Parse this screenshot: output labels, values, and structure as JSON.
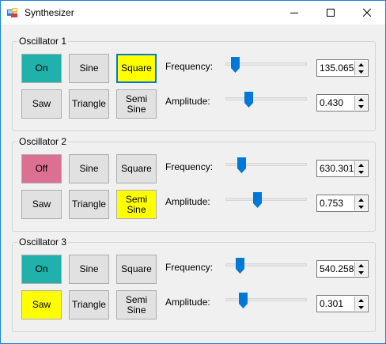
{
  "window": {
    "title": "Synthesizer"
  },
  "colors": {
    "on": "#20b2aa",
    "off": "#db7093",
    "selected": "#ffff00",
    "default": "#e1e1e1",
    "accent": "#0078d7"
  },
  "labels": {
    "frequency": "Frequency:",
    "amplitude": "Amplitude:"
  },
  "oscillators": [
    {
      "title": "Oscillator 1",
      "power": "On",
      "power_state": "on",
      "buttons": [
        "Sine",
        "Square",
        "Saw",
        "Triangle",
        "Semi\nSine"
      ],
      "selected_waveform": "Square",
      "focused_button": "Square",
      "frequency": "135.065",
      "frequency_slider_fraction": 0.06,
      "amplitude": "0.430",
      "amplitude_slider_fraction": 0.25
    },
    {
      "title": "Oscillator 2",
      "power": "Off",
      "power_state": "off",
      "buttons": [
        "Sine",
        "Square",
        "Saw",
        "Triangle",
        "Semi\nSine"
      ],
      "selected_waveform": "Semi\nSine",
      "focused_button": "",
      "frequency": "630.301",
      "frequency_slider_fraction": 0.15,
      "amplitude": "0.753",
      "amplitude_slider_fraction": 0.38
    },
    {
      "title": "Oscillator 3",
      "power": "On",
      "power_state": "on",
      "buttons": [
        "Sine",
        "Square",
        "Saw",
        "Triangle",
        "Semi\nSine"
      ],
      "selected_waveform": "Saw",
      "focused_button": "",
      "frequency": "540.258",
      "frequency_slider_fraction": 0.13,
      "amplitude": "0.301",
      "amplitude_slider_fraction": 0.17
    }
  ]
}
